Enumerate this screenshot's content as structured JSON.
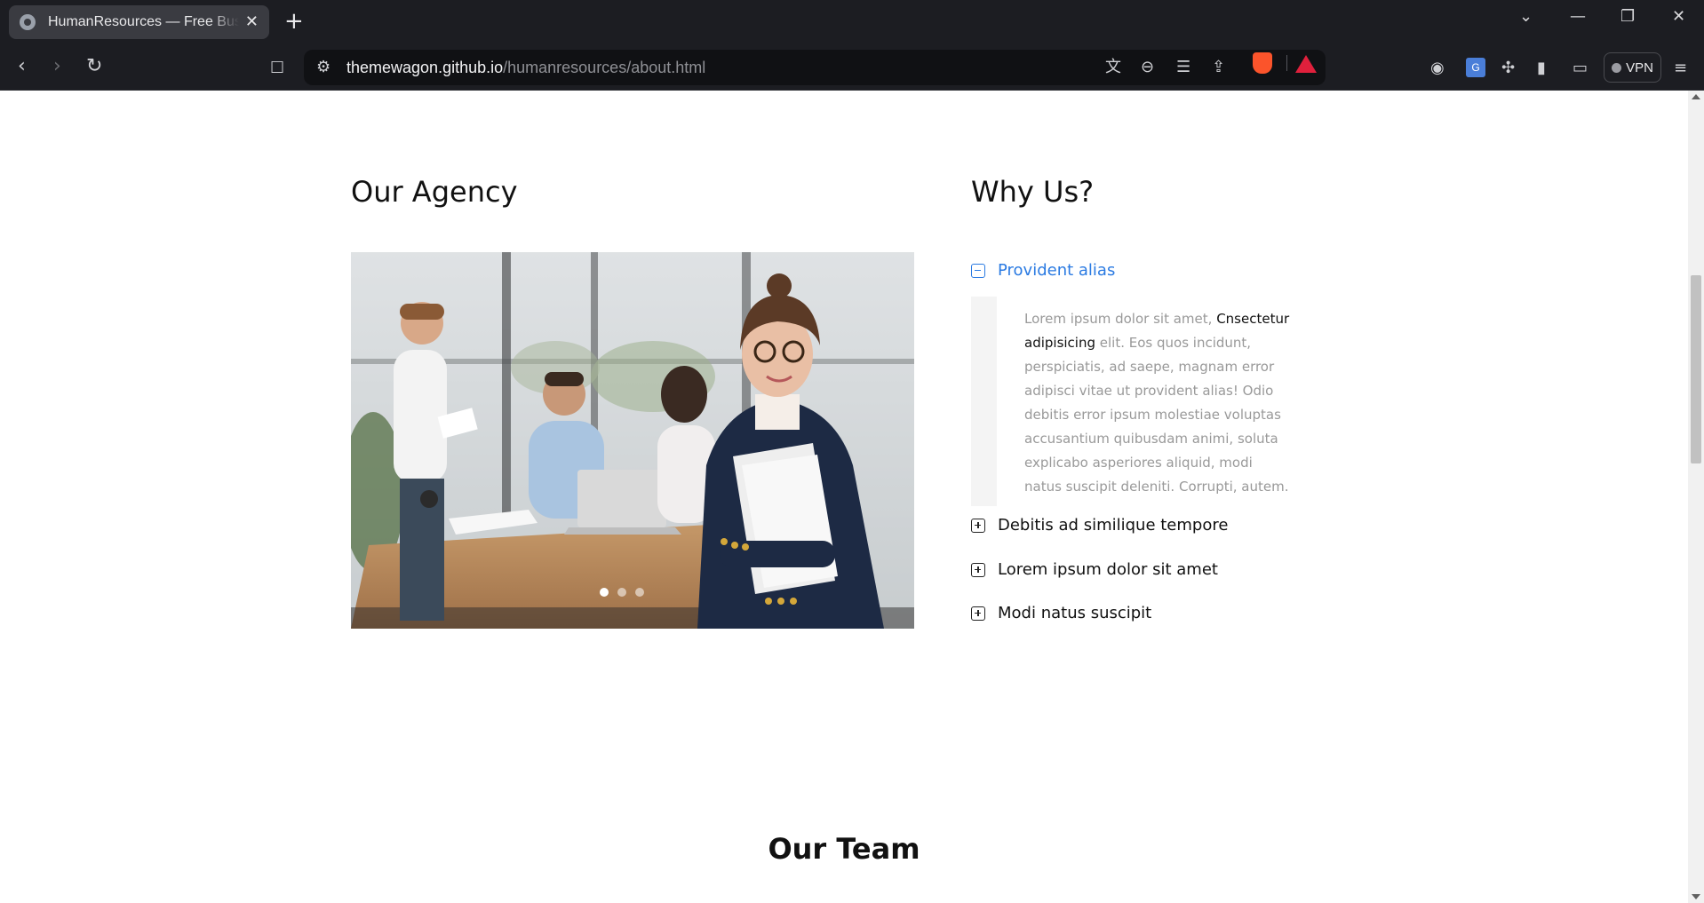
{
  "browser": {
    "tab_title": "HumanResources — Free Business",
    "tab_close": "✕",
    "new_tab": "+",
    "url_host": "themewagon.github.io",
    "url_path": "/humanresources/about.html",
    "vpn_label": "VPN",
    "icons": [
      "back-icon",
      "forward-icon",
      "reload-icon",
      "bookmark-icon",
      "site-settings-icon",
      "translate-icon",
      "zoom-out-icon",
      "reader-icon",
      "share-icon",
      "brave-shields-icon",
      "brave-rewards-icon",
      "extensions-icon",
      "sidebar-icon",
      "wallet-icon",
      "menu-icon"
    ]
  },
  "agency": {
    "title": "Our Agency",
    "slides": 3,
    "active_slide": 1
  },
  "why": {
    "title": "Why Us?",
    "items": [
      {
        "label": "Provident alias",
        "expanded": true,
        "body_start": "Lorem ipsum dolor sit amet,",
        "body_emphasis": "Cnsectetur adipisicing",
        "body_end": "elit. Eos quos incidunt, perspiciatis, ad saepe, magnam error adipisci vitae ut provident alias! Odio debitis error ipsum molestiae voluptas accusantium quibusdam animi, soluta explicabo asperiores aliquid, modi natus suscipit deleniti. Corrupti, autem."
      },
      {
        "label": "Debitis ad similique tempore",
        "expanded": false
      },
      {
        "label": "Lorem ipsum dolor sit amet",
        "expanded": false
      },
      {
        "label": "Modi natus suscipit",
        "expanded": false
      }
    ]
  },
  "team": {
    "title": "Our Team"
  },
  "colors": {
    "accent": "#2a7ae2",
    "chrome_bg": "#1c1d22",
    "url_bg": "#101114",
    "text_muted": "#999999"
  }
}
